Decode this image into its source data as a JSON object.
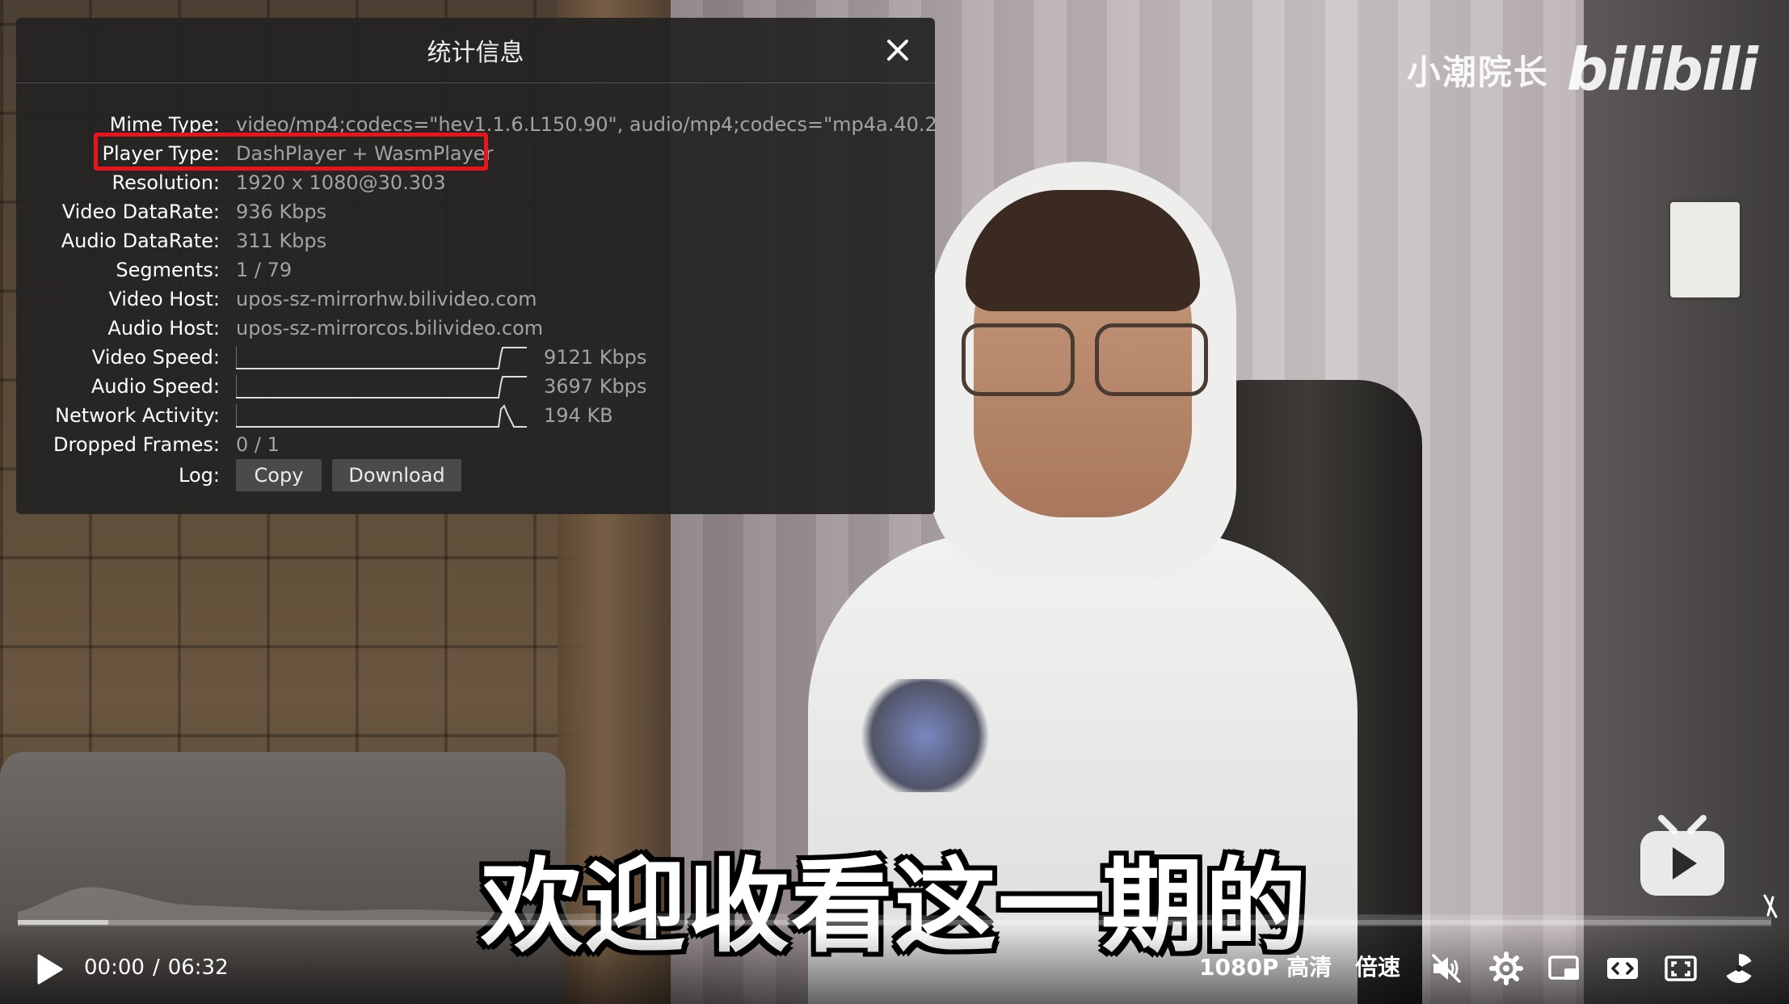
{
  "watermark": {
    "uploader": "小潮院长",
    "logo": "bilibili"
  },
  "subtitle": "欢迎收看这一期的",
  "stats": {
    "title": "统计信息",
    "rows": [
      {
        "label": "Mime Type:",
        "value": "video/mp4;codecs=\"hev1.1.6.L150.90\", audio/mp4;codecs=\"mp4a.40.2\""
      },
      {
        "label": "Player Type:",
        "value": "DashPlayer + WasmPlayer"
      },
      {
        "label": "Resolution:",
        "value": "1920 x 1080@30.303"
      },
      {
        "label": "Video DataRate:",
        "value": "936 Kbps"
      },
      {
        "label": "Audio DataRate:",
        "value": "311 Kbps"
      },
      {
        "label": "Segments:",
        "value": "1 / 79"
      },
      {
        "label": "Video Host:",
        "value": "upos-sz-mirrorhw.bilivideo.com"
      },
      {
        "label": "Audio Host:",
        "value": "upos-sz-mirrorcos.bilivideo.com"
      }
    ],
    "graphs": [
      {
        "label": "Video Speed:",
        "value": "9121 Kbps"
      },
      {
        "label": "Audio Speed:",
        "value": "3697 Kbps"
      },
      {
        "label": "Network Activity:",
        "value": "194 KB"
      }
    ],
    "dropped": {
      "label": "Dropped Frames:",
      "value": "0 / 1"
    },
    "log": {
      "label": "Log:",
      "copy": "Copy",
      "download": "Download"
    },
    "highlight_color": "#e8161c"
  },
  "player": {
    "current_time": "00:00",
    "separator": "/",
    "duration": "06:32",
    "quality": "1080P 高清",
    "speed": "倍速",
    "progress_fraction": 0.0,
    "icons": [
      "play-icon",
      "mute-icon",
      "settings-icon",
      "pip-icon",
      "widescreen-icon",
      "web-fullscreen-icon",
      "fullscreen-icon"
    ]
  }
}
